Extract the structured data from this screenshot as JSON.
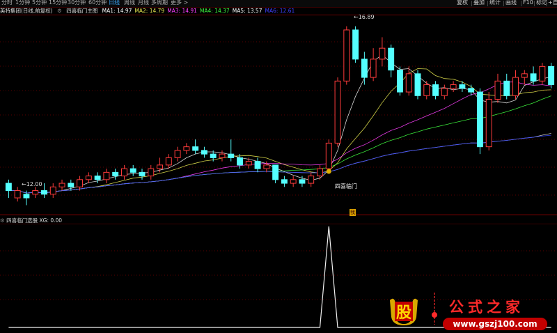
{
  "toolbar": {
    "periods": [
      "分时",
      "1分钟",
      "5分钟",
      "15分钟",
      "30分钟",
      "60分钟",
      "日线",
      "周线",
      "月线",
      "多周期",
      "更多 >"
    ],
    "active_period": "日线",
    "right_buttons": [
      "复权",
      "叠加",
      "统计",
      "画线",
      "F10",
      "标记",
      "+自选"
    ]
  },
  "stock": {
    "name": "英特集团(日线,前复权)",
    "indicator_name": "四喜临门主图",
    "ma": [
      {
        "label": "MA1: 14.97",
        "color": "#ffffff"
      },
      {
        "label": "MA2: 14.79",
        "color": "#e8e850"
      },
      {
        "label": "MA3: 14.91",
        "color": "#ff40ff"
      },
      {
        "label": "MA4: 14.37",
        "color": "#40ff40"
      },
      {
        "label": "MA5: 13.57",
        "color": "#ffffff"
      },
      {
        "label": "MA6: 12.61",
        "color": "#4040ff"
      }
    ]
  },
  "chart_labels": {
    "high": "16.89",
    "low": "12.00",
    "signal": "四喜临门",
    "small_tag": "我"
  },
  "sub_indicator": {
    "name": "四喜临门选股",
    "value_label": "XG: 0.00"
  },
  "chart_data": {
    "type": "candlestick",
    "candles": [
      [
        12.6,
        12.4,
        12.7,
        12.2
      ],
      [
        12.2,
        12.4,
        12.5,
        12.1
      ],
      [
        12.3,
        12.2,
        12.4,
        12.0
      ],
      [
        12.3,
        12.4,
        12.5,
        12.2
      ],
      [
        12.4,
        12.3,
        12.6,
        12.2
      ],
      [
        12.3,
        12.5,
        12.6,
        12.2
      ],
      [
        12.5,
        12.6,
        12.7,
        12.4
      ],
      [
        12.6,
        12.5,
        12.7,
        12.4
      ],
      [
        12.5,
        12.7,
        12.8,
        12.4
      ],
      [
        12.7,
        12.8,
        12.9,
        12.6
      ],
      [
        12.8,
        12.7,
        12.9,
        12.6
      ],
      [
        12.7,
        12.9,
        13.0,
        12.6
      ],
      [
        12.9,
        12.8,
        13.0,
        12.7
      ],
      [
        12.8,
        13.0,
        13.1,
        12.7
      ],
      [
        13.0,
        12.9,
        13.1,
        12.8
      ],
      [
        12.9,
        12.8,
        13.0,
        12.7
      ],
      [
        12.8,
        13.0,
        13.1,
        12.7
      ],
      [
        13.0,
        13.1,
        13.3,
        12.9
      ],
      [
        13.1,
        13.3,
        13.4,
        13.0
      ],
      [
        13.3,
        13.5,
        13.6,
        13.2
      ],
      [
        13.5,
        13.6,
        13.7,
        13.4
      ],
      [
        13.6,
        13.5,
        13.8,
        13.4
      ],
      [
        13.5,
        13.4,
        13.6,
        13.3
      ],
      [
        13.4,
        13.3,
        13.5,
        13.2
      ],
      [
        13.3,
        13.4,
        13.5,
        13.2
      ],
      [
        13.4,
        13.3,
        13.8,
        13.2
      ],
      [
        13.3,
        13.1,
        13.4,
        13.0
      ],
      [
        13.1,
        13.2,
        13.3,
        13.0
      ],
      [
        13.2,
        13.0,
        13.3,
        12.9
      ],
      [
        13.0,
        13.1,
        13.2,
        12.9
      ],
      [
        13.1,
        12.7,
        13.1,
        12.6
      ],
      [
        12.7,
        12.6,
        12.8,
        12.5
      ],
      [
        12.6,
        12.7,
        12.8,
        12.5
      ],
      [
        12.7,
        12.6,
        12.8,
        12.5
      ],
      [
        12.6,
        12.8,
        12.9,
        12.5
      ],
      [
        12.8,
        13.0,
        13.1,
        12.7
      ],
      [
        13.0,
        13.7,
        13.8,
        12.9
      ],
      [
        13.7,
        15.4,
        15.5,
        13.6
      ],
      [
        15.4,
        16.8,
        16.9,
        15.3
      ],
      [
        16.8,
        16.0,
        16.9,
        15.9
      ],
      [
        16.0,
        15.5,
        16.2,
        15.3
      ],
      [
        15.5,
        16.0,
        16.3,
        15.4
      ],
      [
        16.0,
        16.3,
        16.6,
        15.8
      ],
      [
        16.3,
        15.7,
        16.4,
        15.5
      ],
      [
        15.7,
        15.1,
        15.8,
        15.0
      ],
      [
        15.1,
        15.6,
        15.8,
        15.0
      ],
      [
        15.6,
        15.0,
        15.7,
        14.9
      ],
      [
        15.0,
        15.3,
        15.4,
        14.9
      ],
      [
        15.3,
        15.0,
        15.4,
        14.9
      ],
      [
        15.0,
        15.2,
        15.3,
        14.9
      ],
      [
        15.2,
        15.3,
        15.4,
        15.1
      ],
      [
        15.3,
        15.2,
        15.4,
        15.1
      ],
      [
        15.2,
        15.1,
        15.3,
        15.0
      ],
      [
        15.1,
        13.6,
        15.2,
        13.4
      ],
      [
        13.6,
        14.9,
        15.1,
        13.5
      ],
      [
        14.9,
        15.4,
        15.6,
        14.8
      ],
      [
        15.4,
        15.0,
        15.6,
        14.9
      ],
      [
        15.0,
        15.5,
        15.7,
        14.9
      ],
      [
        15.5,
        15.6,
        15.7,
        15.3
      ],
      [
        15.6,
        15.4,
        15.8,
        15.3
      ],
      [
        15.4,
        15.8,
        15.9,
        15.3
      ],
      [
        15.8,
        15.3,
        15.9,
        15.2
      ]
    ],
    "ylim": [
      11.8,
      17.2
    ],
    "signal": [
      0,
      0,
      0,
      0,
      0,
      0,
      0,
      0,
      0,
      0,
      0,
      0,
      0,
      0,
      0,
      0,
      0,
      0,
      0,
      0,
      0,
      0,
      0,
      0,
      0,
      0,
      0,
      0,
      0,
      0,
      0,
      0,
      0,
      0,
      0,
      0,
      1,
      0,
      0,
      0,
      0,
      0,
      0,
      0,
      0,
      0,
      0,
      0,
      0,
      0,
      0,
      0,
      0,
      0,
      0,
      0,
      0,
      0,
      0,
      0,
      0,
      0
    ]
  },
  "watermark": {
    "char": "股",
    "title": "公式之家",
    "url": "www.gszj100.com"
  }
}
